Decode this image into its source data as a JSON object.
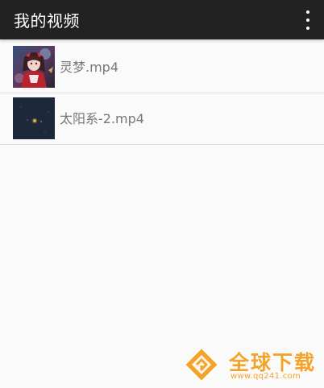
{
  "app_bar": {
    "title": "我的视频",
    "overflow_icon": "more-vert-icon",
    "background": "#222222"
  },
  "videos": [
    {
      "name": "灵梦.mp4",
      "thumbnail": "anime-girl-thumbnail"
    },
    {
      "name": "太阳系-2.mp4",
      "thumbnail": "dark-space-thumbnail"
    }
  ],
  "watermark": {
    "title": "全球下载",
    "url": "www.qq241.com",
    "color": "#f4a32a"
  }
}
